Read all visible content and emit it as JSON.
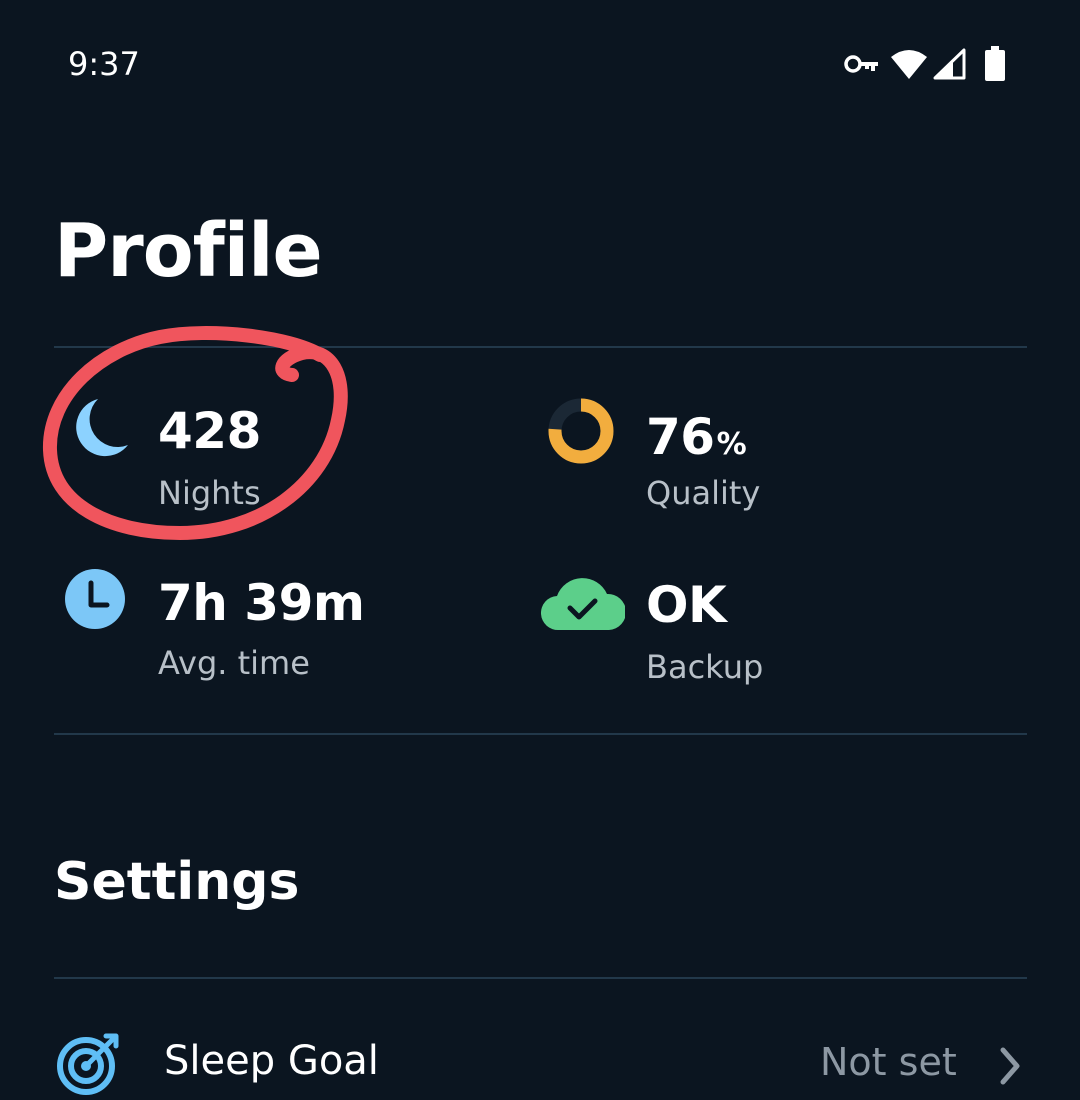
{
  "status_bar": {
    "time": "9:37",
    "icons": [
      "vpn-key-icon",
      "wifi-icon",
      "cell-signal-icon",
      "battery-icon"
    ]
  },
  "page": {
    "title": "Profile"
  },
  "stats": {
    "nights": {
      "value": "428",
      "label": "Nights",
      "icon": "moon-icon",
      "icon_color": "#8cd2ff"
    },
    "quality": {
      "value": "76",
      "unit": "%",
      "label": "Quality",
      "icon": "donut-progress-icon",
      "icon_color": "#f2ad3e",
      "progress_percent": 76
    },
    "avg_time": {
      "value": "7h 39m",
      "label": "Avg. time",
      "icon": "clock-icon",
      "icon_color": "#7cc7f7"
    },
    "backup": {
      "value": "OK",
      "label": "Backup",
      "icon": "cloud-check-icon",
      "icon_color": "#5ccf8a"
    }
  },
  "settings": {
    "title": "Settings",
    "items": [
      {
        "label": "Sleep Goal",
        "value": "Not set",
        "icon": "target-icon",
        "icon_color": "#5fbef5"
      }
    ]
  },
  "annotation": {
    "color": "#f0555d",
    "shape": "hand-drawn-circle"
  },
  "colors": {
    "background": "#0b1520",
    "divider": "#22384a",
    "secondary_text": "#b8c0c8"
  }
}
